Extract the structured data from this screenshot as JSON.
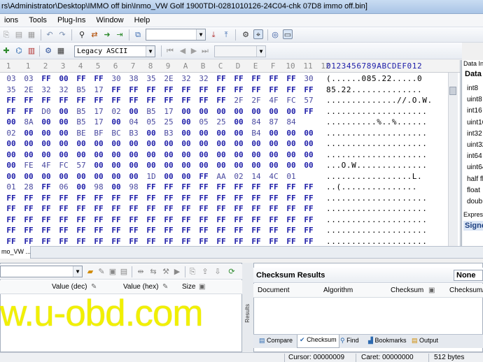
{
  "window": {
    "title": "rs\\Administrator\\Desktop\\IMMO off bin\\Inmo_VW Golf 1900TDI-0281010126-24C04-chk 07D8 immo off.bin]"
  },
  "menu": [
    "ions",
    "Tools",
    "Plug-Ins",
    "Window",
    "Help"
  ],
  "toolbar": {
    "encoding": "Legacy ASCII"
  },
  "hex": {
    "column_headers": [
      "1",
      "2",
      "3",
      "4",
      "5",
      "6",
      "7",
      "8",
      "9",
      "A",
      "B",
      "C",
      "D",
      "E",
      "F",
      "10",
      "11",
      "12"
    ],
    "first_column_partial": "1",
    "ascii_header": "0123456789ABCDEF012",
    "rows": [
      {
        "b": [
          "03",
          "03",
          "FF",
          "00",
          "FF",
          "FF",
          "30",
          "38",
          "35",
          "2E",
          "32",
          "32",
          "FF",
          "FF",
          "FF",
          "FF",
          "FF",
          "30"
        ],
        "a": "(......085.22.....0"
      },
      {
        "b": [
          "35",
          "2E",
          "32",
          "32",
          "B5",
          "17",
          "FF",
          "FF",
          "FF",
          "FF",
          "FF",
          "FF",
          "FF",
          "FF",
          "FF",
          "FF",
          "FF",
          "FF"
        ],
        "a": "85.22.............."
      },
      {
        "b": [
          "FF",
          "FF",
          "FF",
          "FF",
          "FF",
          "FF",
          "FF",
          "FF",
          "FF",
          "FF",
          "FF",
          "FF",
          "FF",
          "2F",
          "2F",
          "4F",
          "FC",
          "57"
        ],
        "a": "..............//.O.W."
      },
      {
        "b": [
          "FF",
          "FF",
          "D0",
          "00",
          "B5",
          "17",
          "02",
          "00",
          "B5",
          "17",
          "00",
          "00",
          "00",
          "00",
          "00",
          "00",
          "00",
          "FF"
        ],
        "a": "...................."
      },
      {
        "b": [
          "00",
          "8A",
          "00",
          "00",
          "B5",
          "17",
          "00",
          "04",
          "05",
          "25",
          "00",
          "05",
          "25",
          "00",
          "84",
          "87",
          "84"
        ],
        "a": "..........%..%......"
      },
      {
        "b": [
          "02",
          "00",
          "00",
          "00",
          "BE",
          "BF",
          "BC",
          "B3",
          "00",
          "B3",
          "00",
          "00",
          "00",
          "00",
          "B4",
          "00",
          "00",
          "00"
        ],
        "a": "...................."
      },
      {
        "b": [
          "00",
          "00",
          "00",
          "00",
          "00",
          "00",
          "00",
          "00",
          "00",
          "00",
          "00",
          "00",
          "00",
          "00",
          "00",
          "00",
          "00",
          "00"
        ],
        "a": "...................."
      },
      {
        "b": [
          "00",
          "00",
          "00",
          "00",
          "00",
          "00",
          "00",
          "00",
          "00",
          "00",
          "00",
          "00",
          "00",
          "00",
          "00",
          "00",
          "00",
          "00"
        ],
        "a": "...................."
      },
      {
        "b": [
          "00",
          "FE",
          "4F",
          "FC",
          "57",
          "00",
          "00",
          "00",
          "00",
          "00",
          "00",
          "00",
          "00",
          "00",
          "00",
          "00",
          "00",
          "00"
        ],
        "a": "...O.W.............."
      },
      {
        "b": [
          "00",
          "00",
          "00",
          "00",
          "00",
          "00",
          "00",
          "00",
          "1D",
          "00",
          "00",
          "FF",
          "AA",
          "02",
          "14",
          "4C",
          "01"
        ],
        "a": ".................L."
      },
      {
        "b": [
          "01",
          "28",
          "FF",
          "06",
          "00",
          "98",
          "00",
          "98",
          "FF",
          "FF",
          "FF",
          "FF",
          "FF",
          "FF",
          "FF",
          "FF",
          "FF",
          "FF"
        ],
        "a": "..(..............."
      },
      {
        "b": [
          "FF",
          "FF",
          "FF",
          "FF",
          "FF",
          "FF",
          "FF",
          "FF",
          "FF",
          "FF",
          "FF",
          "FF",
          "FF",
          "FF",
          "FF",
          "FF",
          "FF",
          "FF"
        ],
        "a": "...................."
      },
      {
        "b": [
          "FF",
          "FF",
          "FF",
          "FF",
          "FF",
          "FF",
          "FF",
          "FF",
          "FF",
          "FF",
          "FF",
          "FF",
          "FF",
          "FF",
          "FF",
          "FF",
          "FF",
          "FF"
        ],
        "a": "...................."
      },
      {
        "b": [
          "FF",
          "FF",
          "FF",
          "FF",
          "FF",
          "FF",
          "FF",
          "FF",
          "FF",
          "FF",
          "FF",
          "FF",
          "FF",
          "FF",
          "FF",
          "FF",
          "FF",
          "FF"
        ],
        "a": "...................."
      },
      {
        "b": [
          "FF",
          "FF",
          "FF",
          "FF",
          "FF",
          "FF",
          "FF",
          "FF",
          "FF",
          "FF",
          "FF",
          "FF",
          "FF",
          "FF",
          "FF",
          "FF",
          "FF",
          "FF"
        ],
        "a": "...................."
      },
      {
        "b": [
          "FF",
          "FF",
          "FF",
          "FF",
          "FF",
          "FF",
          "FF",
          "FF",
          "FF",
          "FF",
          "FF",
          "FF",
          "FF",
          "FF",
          "FF",
          "FF",
          "FF",
          "FF"
        ],
        "a": "...................."
      }
    ]
  },
  "inspector": {
    "title": "Data In",
    "header": "Data",
    "types": [
      "int8",
      "uint8",
      "int16",
      "uint16",
      "int32",
      "uint32",
      "int64",
      "uint64",
      "half fl",
      "float",
      "doub"
    ],
    "expression_label": "Express",
    "signed_label": "Signe"
  },
  "file_tab": "mo_VW ...",
  "structure": {
    "columns": {
      "value_dec": "Value (dec)",
      "value_hex": "Value (hex)",
      "size": "Size"
    },
    "watermark": "w.u-obd.com"
  },
  "results_label": "Results",
  "checksum": {
    "title": "Checksum Results",
    "mode": "None",
    "columns": [
      "Document",
      "Algorithm",
      "Checksum",
      "Checksum/"
    ],
    "tabs": [
      "Compare",
      "Checksum",
      "Find",
      "Bookmarks",
      "Output"
    ]
  },
  "status": {
    "cursor": "Cursor: 00000009",
    "caret": "Caret: 00000000",
    "size": "512 bytes"
  },
  "colors": {
    "hex_text": "#1c1ca8",
    "watermark": "#f1f000",
    "titlebar": "#b9d1ee"
  }
}
